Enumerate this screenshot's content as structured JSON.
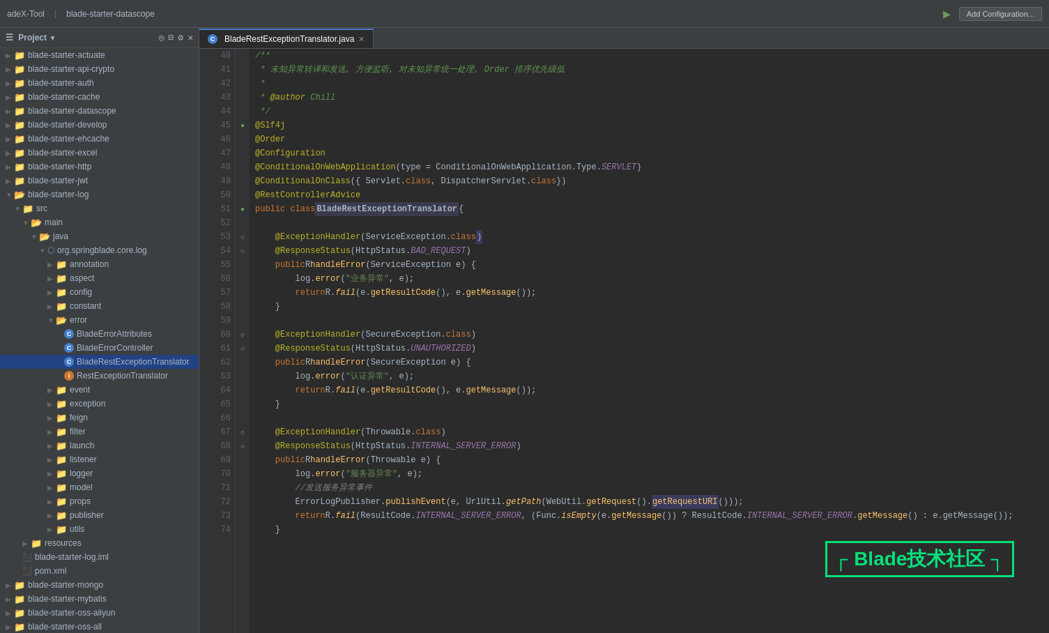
{
  "toolbar": {
    "tool_label": "adeX-Tool",
    "project_label": "blade-starter-datascope",
    "project_tab": "Project",
    "add_config_label": "Add Configuration..."
  },
  "sidebar": {
    "title": "Project",
    "items": [
      {
        "label": "blade-starter-actuate",
        "level": 0,
        "type": "module"
      },
      {
        "label": "blade-starter-api-crypto",
        "level": 0,
        "type": "module"
      },
      {
        "label": "blade-starter-auth",
        "level": 0,
        "type": "module"
      },
      {
        "label": "blade-starter-cache",
        "level": 0,
        "type": "module"
      },
      {
        "label": "blade-starter-datascope",
        "level": 0,
        "type": "module-open"
      },
      {
        "label": "blade-starter-develop",
        "level": 0,
        "type": "module"
      },
      {
        "label": "blade-starter-ehcache",
        "level": 0,
        "type": "module"
      },
      {
        "label": "blade-starter-excel",
        "level": 0,
        "type": "module"
      },
      {
        "label": "blade-starter-http",
        "level": 0,
        "type": "module"
      },
      {
        "label": "blade-starter-jwt",
        "level": 0,
        "type": "module"
      },
      {
        "label": "blade-starter-log",
        "level": 0,
        "type": "module-open"
      },
      {
        "label": "src",
        "level": 1,
        "type": "folder"
      },
      {
        "label": "main",
        "level": 2,
        "type": "folder-open"
      },
      {
        "label": "java",
        "level": 3,
        "type": "folder-open"
      },
      {
        "label": "org.springblade.core.log",
        "level": 4,
        "type": "package"
      },
      {
        "label": "annotation",
        "level": 5,
        "type": "folder"
      },
      {
        "label": "aspect",
        "level": 5,
        "type": "folder"
      },
      {
        "label": "config",
        "level": 5,
        "type": "folder"
      },
      {
        "label": "constant",
        "level": 5,
        "type": "folder"
      },
      {
        "label": "error",
        "level": 5,
        "type": "folder-open"
      },
      {
        "label": "BladeErrorAttributes",
        "level": 6,
        "type": "java"
      },
      {
        "label": "BladeErrorController",
        "level": 6,
        "type": "java"
      },
      {
        "label": "BladeRestExceptionTranslator",
        "level": 6,
        "type": "java-active"
      },
      {
        "label": "RestExceptionTranslator",
        "level": 6,
        "type": "java"
      },
      {
        "label": "event",
        "level": 5,
        "type": "folder"
      },
      {
        "label": "exception",
        "level": 5,
        "type": "folder"
      },
      {
        "label": "feign",
        "level": 5,
        "type": "folder"
      },
      {
        "label": "filter",
        "level": 5,
        "type": "folder"
      },
      {
        "label": "launch",
        "level": 5,
        "type": "folder"
      },
      {
        "label": "listener",
        "level": 5,
        "type": "folder"
      },
      {
        "label": "logger",
        "level": 5,
        "type": "folder"
      },
      {
        "label": "model",
        "level": 5,
        "type": "folder"
      },
      {
        "label": "props",
        "level": 5,
        "type": "folder"
      },
      {
        "label": "publisher",
        "level": 5,
        "type": "folder"
      },
      {
        "label": "utils",
        "level": 5,
        "type": "folder"
      },
      {
        "label": "resources",
        "level": 2,
        "type": "folder"
      },
      {
        "label": "blade-starter-log.iml",
        "level": 1,
        "type": "iml"
      },
      {
        "label": "pom.xml",
        "level": 1,
        "type": "xml"
      },
      {
        "label": "blade-starter-mongo",
        "level": 0,
        "type": "module"
      },
      {
        "label": "blade-starter-mybatis",
        "level": 0,
        "type": "module"
      },
      {
        "label": "blade-starter-oss-aliyun",
        "level": 0,
        "type": "module"
      },
      {
        "label": "blade-starter-oss-all",
        "level": 0,
        "type": "module"
      }
    ]
  },
  "editor": {
    "tab_label": "BladeRestExceptionTranslator.java",
    "lines": [
      {
        "num": "40",
        "content": "/**"
      },
      {
        "num": "41",
        "content": " * 未知异常转译和发送, 方便监听, 对未知异常统一处理, Order 排序优先级低"
      },
      {
        "num": "42",
        "content": " *"
      },
      {
        "num": "43",
        "content": " * @author Chill"
      },
      {
        "num": "44",
        "content": " */"
      },
      {
        "num": "45",
        "content": "@Slf4j"
      },
      {
        "num": "46",
        "content": "@Order"
      },
      {
        "num": "47",
        "content": "@Configuration"
      },
      {
        "num": "48",
        "content": "@ConditionalOnWebApplication(type = ConditionalOnWebApplication.Type.SERVLET)"
      },
      {
        "num": "49",
        "content": "@ConditionalOnClass({ Servlet.class, DispatcherServlet.class })"
      },
      {
        "num": "50",
        "content": "@RestControllerAdvice"
      },
      {
        "num": "51",
        "content": "public class BladeRestExceptionTranslator {"
      },
      {
        "num": "52",
        "content": ""
      },
      {
        "num": "53",
        "content": "    @ExceptionHandler(ServiceException.class)"
      },
      {
        "num": "54",
        "content": "    @ResponseStatus(HttpStatus.BAD_REQUEST)"
      },
      {
        "num": "55",
        "content": "    public R handleError(ServiceException e) {"
      },
      {
        "num": "56",
        "content": "        log.error(\"业务异常\", e);"
      },
      {
        "num": "57",
        "content": "        return R.fail(e.getResultCode(), e.getMessage());"
      },
      {
        "num": "58",
        "content": "    }"
      },
      {
        "num": "59",
        "content": ""
      },
      {
        "num": "60",
        "content": "    @ExceptionHandler(SecureException.class)"
      },
      {
        "num": "61",
        "content": "    @ResponseStatus(HttpStatus.UNAUTHORIZED)"
      },
      {
        "num": "62",
        "content": "    public R handleError(SecureException e) {"
      },
      {
        "num": "63",
        "content": "        log.error(\"认证异常\", e);"
      },
      {
        "num": "64",
        "content": "        return R.fail(e.getResultCode(), e.getMessage());"
      },
      {
        "num": "65",
        "content": "    }"
      },
      {
        "num": "66",
        "content": ""
      },
      {
        "num": "67",
        "content": "    @ExceptionHandler(Throwable.class)"
      },
      {
        "num": "68",
        "content": "    @ResponseStatus(HttpStatus.INTERNAL_SERVER_ERROR)"
      },
      {
        "num": "69",
        "content": "    public R handleError(Throwable e) {"
      },
      {
        "num": "70",
        "content": "        log.error(\"服务器异常\", e);"
      },
      {
        "num": "71",
        "content": "        //发送服务异常事件"
      },
      {
        "num": "72",
        "content": "        ErrorLogPublisher.publishEvent(e, UrlUtil.getPath(WebUtil.getRequest().getRequestURI()));"
      },
      {
        "num": "73",
        "content": "        return R.fail(ResultCode.INTERNAL_SERVER_ERROR, (Func.isEmpty(e.getMessage()) ? ResultCode.INTERNAL_SERVER_ERROR.getMessage() : e.getMessage());"
      },
      {
        "num": "74",
        "content": "    }"
      }
    ]
  },
  "watermark": {
    "text": "Blade技术社区"
  }
}
